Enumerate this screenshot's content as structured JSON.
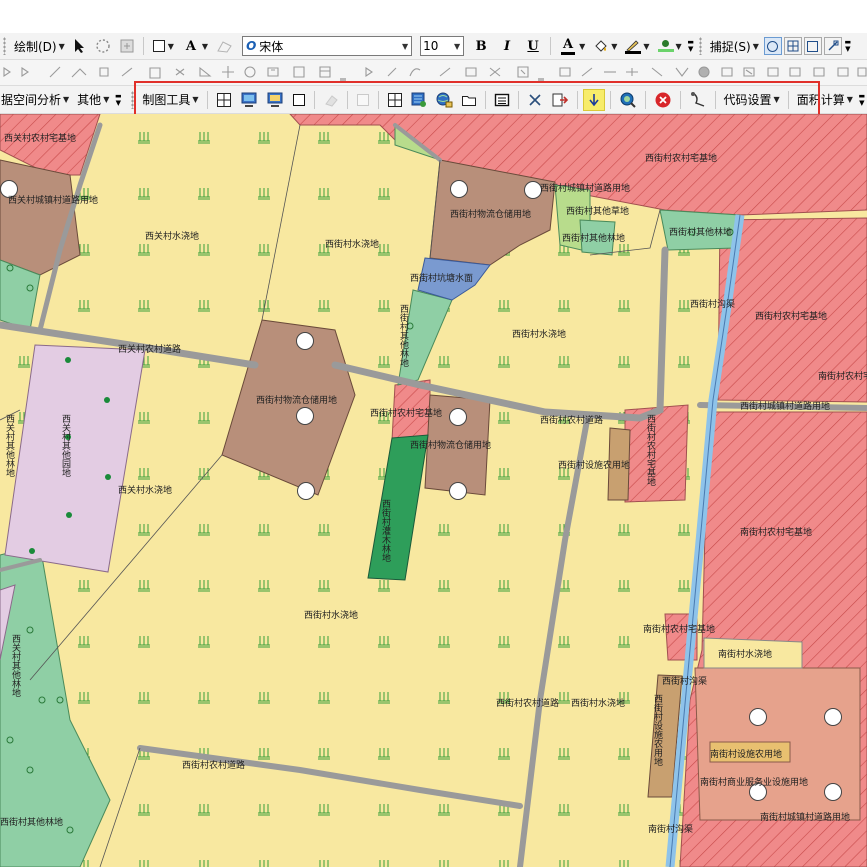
{
  "toolbar1": {
    "draw_label": "绘制(D)",
    "font_name": "宋体",
    "font_size": "10",
    "bold": "B",
    "italic": "I",
    "underline": "U",
    "font_color_glyph": "A",
    "text_tool_glyph": "A",
    "snap_label": "捕捉(S)"
  },
  "toolbar3": {
    "spatial_analysis_label": "据空间分析",
    "other_label": "其他",
    "cartography_tools_label": "制图工具",
    "code_settings_label": "代码设置",
    "area_calc_label": "面积计算"
  },
  "colors": {
    "water_land": "#f8e8a0",
    "rural_homestead": "#f08a8a",
    "storage_land": "#b88f7a",
    "forest_land": "#8fcfa5",
    "road": "#9a9a9a",
    "ditch": "#8ec3ea",
    "other_garden": "#e3cce3",
    "shrub_forest": "#2e9e5a",
    "highlight_box": "#e0302a"
  },
  "map": {
    "labels": [
      "西关村农村宅基地",
      "西关村城镇村道路用地",
      "西关村水浇地",
      "西街村水浇地",
      "西街村物流仓储用地",
      "西街村城镇村道路用地",
      "西街村农村宅基地",
      "西街村其他草地",
      "西街村其他林地",
      "西街村坑塘水面",
      "西街村其他林地",
      "西街村水浇地",
      "西关村农村道路",
      "西街村物流仓储用地",
      "西街村农村宅基地",
      "西街村农村道路",
      "西街村物流仓储用地",
      "西关村其他园地",
      "西关村水浇地",
      "西街村设施农用地",
      "西街村灌木林地",
      "西街村农村宅基地",
      "西街村沟渠",
      "西街村农村宅基地",
      "南街村农村宅基地",
      "西街村城镇村道路用地",
      "南街村农村宅基地",
      "西街村水浇地",
      "南街村农村宅基地",
      "南街村水浇地",
      "西街村沟渠",
      "西街村农村道路",
      "西街村水浇地",
      "西街村设施农用地",
      "南街村设施农用地",
      "南街村商业服务业设施用地",
      "西街村农村道路",
      "南街村城镇村道路用地",
      "西街村其他林地",
      "南街村沟渠",
      "西关村其他林地",
      "西关村其他林地",
      "西街村其他林地"
    ]
  }
}
